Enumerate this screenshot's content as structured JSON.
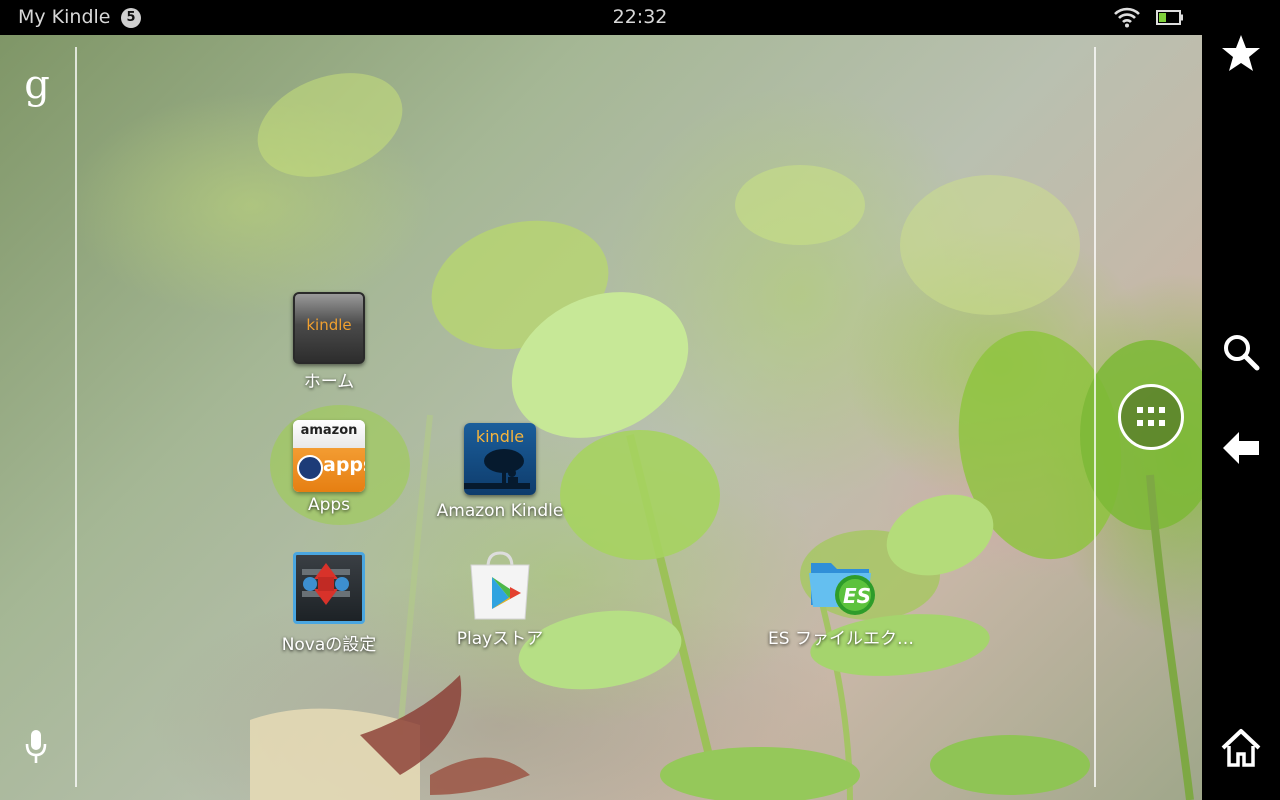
{
  "status_bar": {
    "title": "My Kindle",
    "notification_count": "5",
    "time": "22:32",
    "wifi_icon": "wifi-icon",
    "battery_icon": "battery-icon",
    "battery_color": "#7fd13b"
  },
  "desktop": {
    "google_search_glyph": "g",
    "voice_icon": "mic-icon",
    "app_drawer_icon": "grid-icon",
    "apps": [
      {
        "label": "ホーム",
        "icon": "kindle-home-icon",
        "tile_text": "kindle"
      },
      {
        "label": "Apps",
        "icon": "amazon-appstore-icon",
        "tile_text_top": "amazon",
        "tile_text_bottom": "apps"
      },
      {
        "label": "Amazon Kindle",
        "icon": "kindle-reader-icon",
        "tile_text": "kindle"
      },
      {
        "label": "Novaの設定",
        "icon": "nova-settings-icon"
      },
      {
        "label": "Playストア",
        "icon": "play-store-icon"
      },
      {
        "label": "ES ファイルエク…",
        "icon": "es-file-explorer-icon"
      }
    ]
  },
  "nav_bar": {
    "buttons": [
      "star-icon",
      "search-icon",
      "back-arrow-icon",
      "home-icon"
    ]
  }
}
